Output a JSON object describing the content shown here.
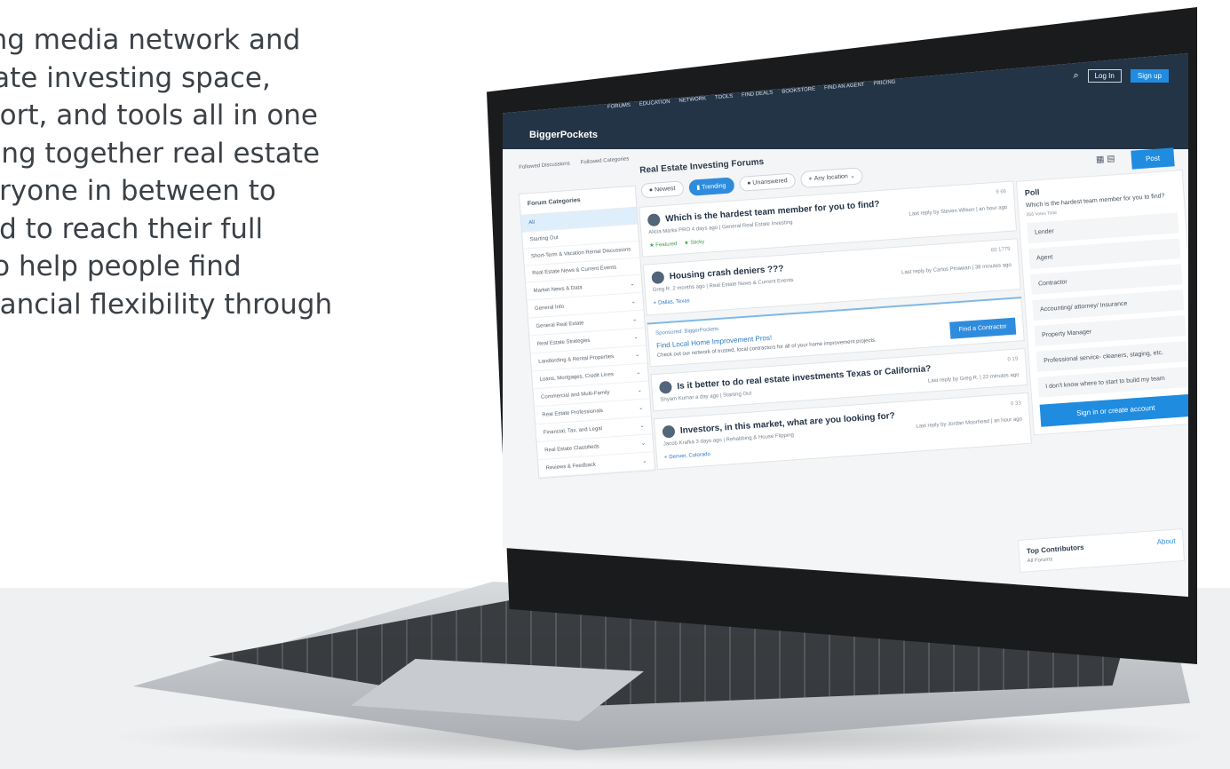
{
  "intro": {
    "lines": [
      "ing media network and",
      "tate investing space,",
      "port, and tools all in one",
      "ring together real estate",
      "eryone in between to",
      "ed to reach their full",
      "to help people find",
      "nancial flexibility through"
    ]
  },
  "app": {
    "logo": "BiggerPockets",
    "nav": [
      "FORUMS",
      "EDUCATION",
      "NETWORK",
      "TOOLS",
      "FIND DEALS",
      "BOOKSTORE",
      "FIND AN AGENT",
      "PRICING"
    ],
    "search_icon": "search-icon",
    "login": "Log In",
    "signup": "Sign up",
    "tabs": [
      "Followed Discussions",
      "Followed Categories"
    ],
    "post_button": "Post",
    "view_icons": "▦ ▤"
  },
  "sidebar": {
    "title": "Forum Categories",
    "items": [
      {
        "label": "All",
        "active": true
      },
      {
        "label": "Starting Out"
      },
      {
        "label": "Short-Term & Vacation Rental Discussions"
      },
      {
        "label": "Real Estate News & Current Events"
      },
      {
        "label": "Market News & Data"
      },
      {
        "label": "General Info"
      },
      {
        "label": "General Real Estate"
      },
      {
        "label": "Real Estate Strategies"
      },
      {
        "label": "Landlording & Rental Properties"
      },
      {
        "label": "Loans, Mortgages, Credit Lines"
      },
      {
        "label": "Commercial and Multi-Family"
      },
      {
        "label": "Real Estate Professionals"
      },
      {
        "label": "Financial, Tax, and Legal"
      },
      {
        "label": "Real Estate Classifieds"
      },
      {
        "label": "Reviews & Feedback"
      }
    ]
  },
  "forum": {
    "title": "Real Estate Investing Forums",
    "filters": {
      "newest": "Newest",
      "trending": "Trending",
      "unanswered": "Unanswered",
      "location": "Any location"
    },
    "posts": [
      {
        "title": "Which is the hardest team member for you to find?",
        "author": "Alicia Marks",
        "badge": "PRO",
        "meta": "4 days ago | General Real Estate Investing",
        "last": "Last reply by Steven Wilson | an hour ago",
        "stats": "9  66",
        "tags": [
          "★ Featured",
          "★ Sticky"
        ]
      },
      {
        "title": "Housing crash deniers ???",
        "author": "Greg R.",
        "meta": "2 months ago | Real Estate News & Current Events",
        "last": "Last reply by Carlos Ptriawan | 38 minutes ago",
        "stats": "60  1779",
        "location": "Dallas, Texas"
      },
      {
        "title": "Is it better to do real estate investments Texas or California?",
        "author": "Shyam Kumar",
        "meta": "a day ago | Starting Out",
        "last": "Last reply by Greg R. | 22 minutes ago",
        "stats": "0  19"
      },
      {
        "title": "Investors, in this market, what are you looking for?",
        "author": "Jacob Krafka",
        "meta": "3 days ago | Rehabbing & House Flipping",
        "last": "Last reply by Jordan Moorhead | an hour ago",
        "stats": "0  33",
        "location": "Denver, Colorado"
      }
    ],
    "sponsored": {
      "label": "Sponsored: BiggerPockets",
      "title": "Find Local Home Improvement Pros!",
      "desc": "Check out our network of trusted, local contractors for all of your home improvement projects.",
      "button": "Find a Contractor"
    }
  },
  "poll": {
    "title": "Poll",
    "question": "Which is the hardest team member for you to find?",
    "votes": "356 Votes Total",
    "options": [
      "Lender",
      "Agent",
      "Contractor",
      "Accounting/ attorney/ Insurance",
      "Property Manager",
      "Professional service- cleaners, staging, etc.",
      "I don't know where to start to build my team"
    ],
    "signin": "Sign in or create account"
  },
  "contributors": {
    "title": "Top Contributors",
    "about": "About",
    "subtitle": "All Forums"
  }
}
